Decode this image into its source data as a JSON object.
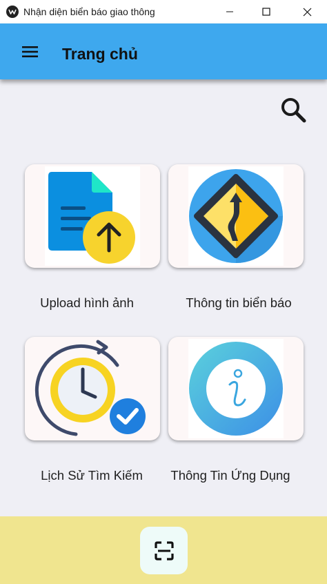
{
  "window": {
    "title": "Nhận diện biển báo giao thông"
  },
  "appbar": {
    "title": "Trang chủ"
  },
  "cards": [
    {
      "label": "Upload hình ảnh",
      "icon": "document-upload-icon"
    },
    {
      "label": "Thông tin biển báo",
      "icon": "winding-road-sign-icon"
    },
    {
      "label": "Lịch Sử Tìm Kiếm",
      "icon": "history-clock-icon"
    },
    {
      "label": "Thông Tin Ứng Dụng",
      "icon": "info-icon"
    }
  ],
  "colors": {
    "appbar": "#3ea8ee",
    "background": "#efeff5",
    "bottom_bar": "#f0e58f",
    "card": "#fdf7f7"
  }
}
